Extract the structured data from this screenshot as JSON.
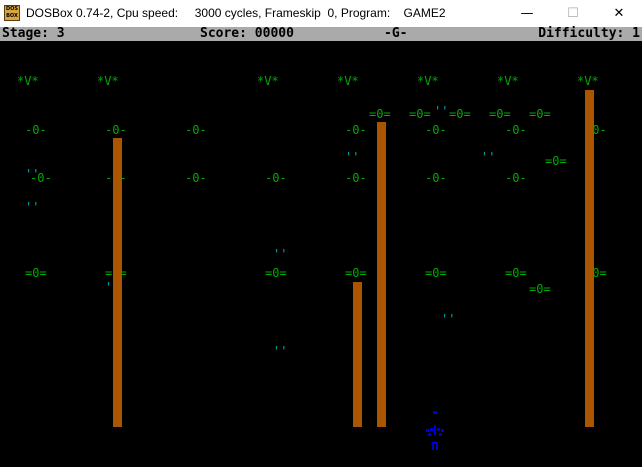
{
  "window": {
    "title": "DOSBox 0.74-2, Cpu speed:     3000 cycles, Frameskip  0, Program:    GAME2",
    "icon_name": "dosbox-icon",
    "icon_text": "DOS BOX",
    "minimize": "—",
    "maximize": "☐",
    "close": "✕"
  },
  "status": {
    "stage": "Stage: 3",
    "score": "Score: 00000",
    "mode": "-G-",
    "difficulty": "Difficulty: 1"
  },
  "game": {
    "invader_top": "*V*",
    "invader_o": "-0-",
    "invader_eq": "=0=",
    "enemy_shot": "''",
    "colors": {
      "green": "#00aa00",
      "cyan": "#00aaaa",
      "pillar": "#aa5500",
      "player": "#0000cc"
    }
  }
}
